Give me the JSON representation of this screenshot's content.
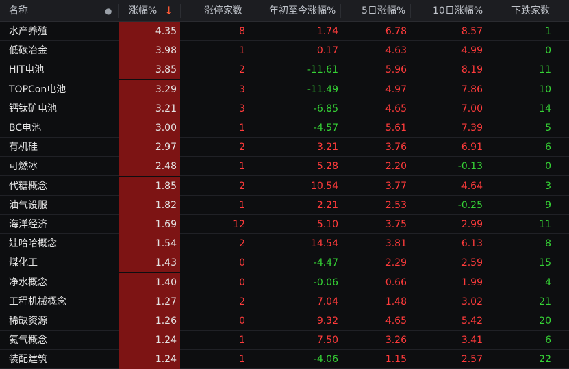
{
  "header": {
    "name": "名称",
    "pct": "涨幅%",
    "sort_arrow": "↓",
    "limit_up": "涨停家数",
    "ytd": "年初至今涨幅%",
    "d5": "5日涨幅%",
    "d10": "10日涨幅%",
    "down": "下跌家数"
  },
  "colors": {
    "up": "#ff3b3b",
    "down": "#35d135",
    "highlight": "#7d1414"
  },
  "rows": [
    {
      "name": "水产养殖",
      "pct": "4.35",
      "limit_up": "8",
      "ytd": "1.74",
      "d5": "6.78",
      "d10": "8.57",
      "down": "1"
    },
    {
      "name": "低碳冶金",
      "pct": "3.98",
      "limit_up": "1",
      "ytd": "0.17",
      "d5": "4.63",
      "d10": "4.99",
      "down": "0"
    },
    {
      "name": "HIT电池",
      "pct": "3.85",
      "limit_up": "2",
      "ytd": "-11.61",
      "d5": "5.96",
      "d10": "8.19",
      "down": "11"
    },
    {
      "name": "TOPCon电池",
      "pct": "3.29",
      "limit_up": "3",
      "ytd": "-11.49",
      "d5": "4.97",
      "d10": "7.86",
      "down": "10"
    },
    {
      "name": "钙钛矿电池",
      "pct": "3.21",
      "limit_up": "3",
      "ytd": "-6.85",
      "d5": "4.65",
      "d10": "7.00",
      "down": "14"
    },
    {
      "name": "BC电池",
      "pct": "3.00",
      "limit_up": "1",
      "ytd": "-4.57",
      "d5": "5.61",
      "d10": "7.39",
      "down": "5"
    },
    {
      "name": "有机硅",
      "pct": "2.97",
      "limit_up": "2",
      "ytd": "3.21",
      "d5": "3.76",
      "d10": "6.91",
      "down": "6"
    },
    {
      "name": "可燃冰",
      "pct": "2.48",
      "limit_up": "1",
      "ytd": "5.28",
      "d5": "2.20",
      "d10": "-0.13",
      "down": "0"
    },
    {
      "name": "代糖概念",
      "pct": "1.85",
      "limit_up": "2",
      "ytd": "10.54",
      "d5": "3.77",
      "d10": "4.64",
      "down": "3"
    },
    {
      "name": "油气设服",
      "pct": "1.82",
      "limit_up": "1",
      "ytd": "2.21",
      "d5": "2.53",
      "d10": "-0.25",
      "down": "9"
    },
    {
      "name": "海洋经济",
      "pct": "1.69",
      "limit_up": "12",
      "ytd": "5.10",
      "d5": "3.75",
      "d10": "2.99",
      "down": "11"
    },
    {
      "name": "娃哈哈概念",
      "pct": "1.54",
      "limit_up": "2",
      "ytd": "14.54",
      "d5": "3.81",
      "d10": "6.13",
      "down": "8"
    },
    {
      "name": "煤化工",
      "pct": "1.43",
      "limit_up": "0",
      "ytd": "-4.47",
      "d5": "2.29",
      "d10": "2.59",
      "down": "15"
    },
    {
      "name": "净水概念",
      "pct": "1.40",
      "limit_up": "0",
      "ytd": "-0.06",
      "d5": "0.66",
      "d10": "1.99",
      "down": "4"
    },
    {
      "name": "工程机械概念",
      "pct": "1.27",
      "limit_up": "2",
      "ytd": "7.04",
      "d5": "1.48",
      "d10": "3.02",
      "down": "21"
    },
    {
      "name": "稀缺资源",
      "pct": "1.26",
      "limit_up": "0",
      "ytd": "9.32",
      "d5": "4.65",
      "d10": "5.42",
      "down": "20"
    },
    {
      "name": "氦气概念",
      "pct": "1.24",
      "limit_up": "1",
      "ytd": "7.50",
      "d5": "3.26",
      "d10": "3.41",
      "down": "6"
    },
    {
      "name": "装配建筑",
      "pct": "1.24",
      "limit_up": "1",
      "ytd": "-4.06",
      "d5": "1.15",
      "d10": "2.57",
      "down": "22"
    }
  ]
}
